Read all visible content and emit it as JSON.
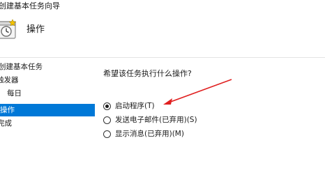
{
  "window": {
    "title": "创建基本任务向导"
  },
  "header": {
    "title": "操作",
    "icon": "task-clock-icon"
  },
  "sidebar": {
    "items": [
      {
        "label": "创建基本任务",
        "selected": false
      },
      {
        "label": "触发器",
        "selected": false
      },
      {
        "label": "每日",
        "selected": false
      },
      {
        "label": "操作",
        "selected": true
      },
      {
        "label": "完成",
        "selected": false
      }
    ]
  },
  "main": {
    "question": "希望该任务执行什么操作?",
    "options": [
      {
        "label": "启动程序(T)",
        "checked": true
      },
      {
        "label": "发送电子邮件(已弃用)(S)",
        "checked": false
      },
      {
        "label": "显示消息(已弃用)(M)",
        "checked": false
      }
    ]
  },
  "colors": {
    "selection": "#0078d7",
    "annotation_arrow": "#e02020"
  }
}
